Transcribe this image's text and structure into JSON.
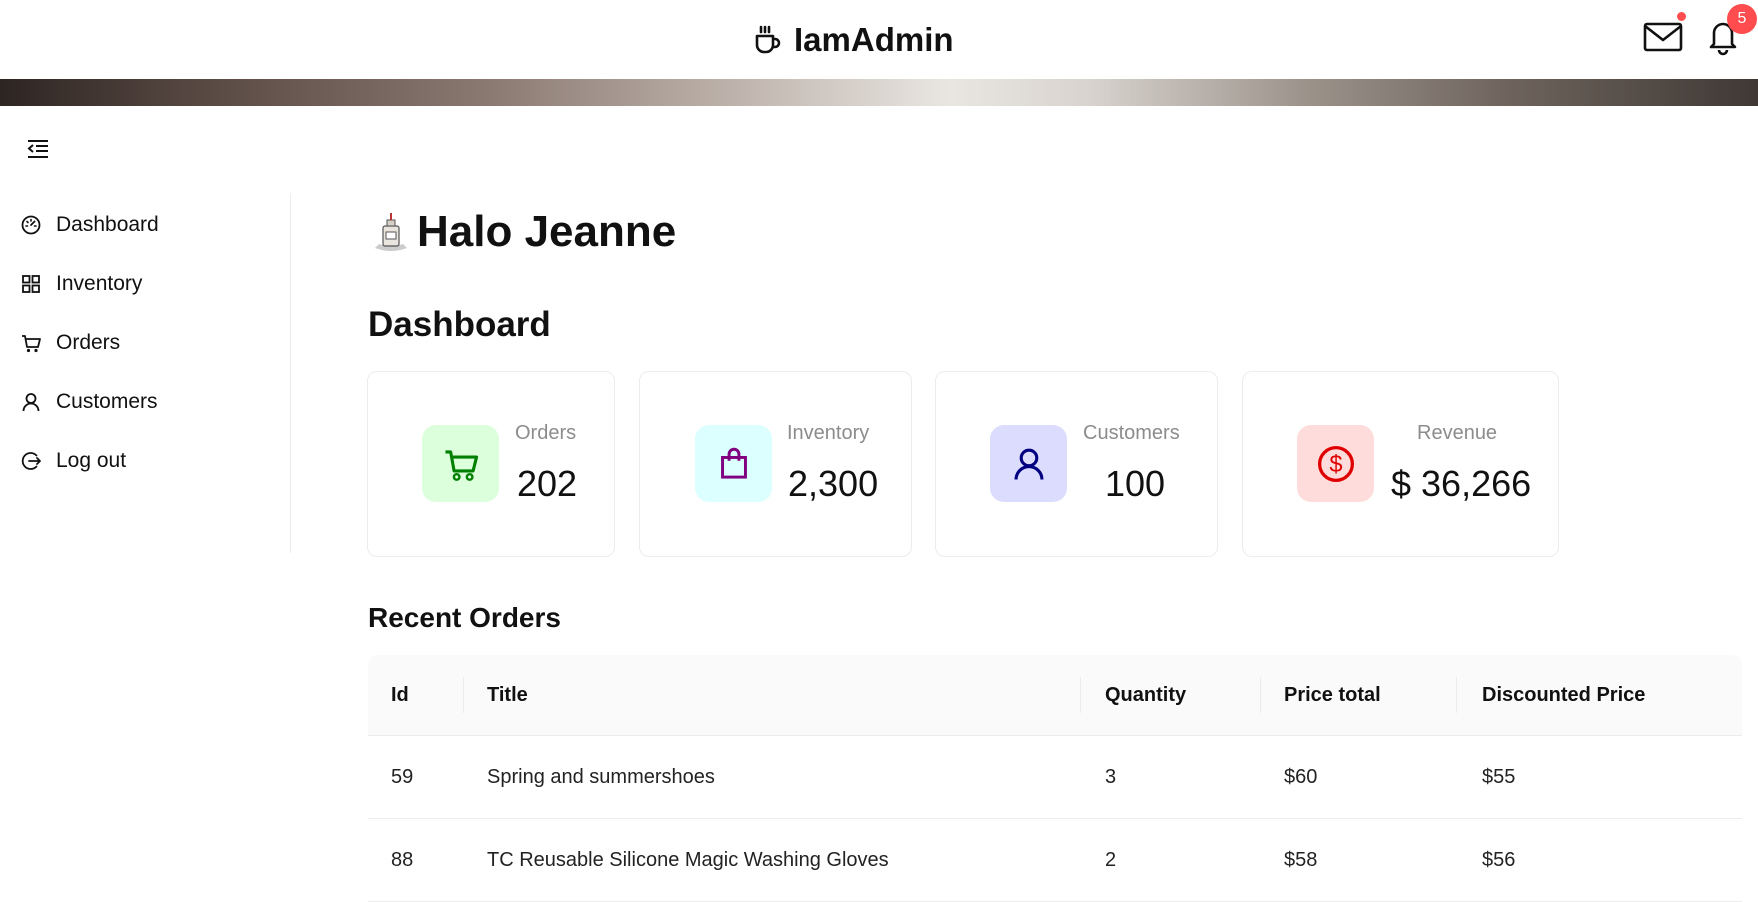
{
  "app": {
    "title": "IamAdmin"
  },
  "header": {
    "notification_count": "5"
  },
  "sidebar": {
    "items": [
      {
        "label": "Dashboard",
        "icon": "speedometer-icon"
      },
      {
        "label": "Inventory",
        "icon": "grid-icon"
      },
      {
        "label": "Orders",
        "icon": "cart-icon"
      },
      {
        "label": "Customers",
        "icon": "user-icon"
      },
      {
        "label": "Log out",
        "icon": "logout-icon"
      }
    ]
  },
  "main": {
    "greeting": "Halo Jeanne",
    "dashboard_title": "Dashboard",
    "cards": [
      {
        "label": "Orders",
        "value": "202",
        "icon": "cart-icon",
        "color": "#008000",
        "bg": "#dcffdc"
      },
      {
        "label": "Inventory",
        "value": "2,300",
        "icon": "shopping-bag-icon",
        "color": "#800080",
        "bg": "#dcffff"
      },
      {
        "label": "Customers",
        "value": "100",
        "icon": "user-icon",
        "color": "#000080",
        "bg": "#dcdcff"
      },
      {
        "label": "Revenue",
        "value": "$ 36,266",
        "icon": "dollar-circle-icon",
        "color": "#e00000",
        "bg": "#ffdcdc"
      }
    ],
    "recent_orders": {
      "title": "Recent Orders",
      "columns": [
        "Id",
        "Title",
        "Quantity",
        "Price total",
        "Discounted Price"
      ],
      "rows": [
        [
          "59",
          "Spring and summershoes",
          "3",
          "$60",
          "$55"
        ],
        [
          "88",
          "TC Reusable Silicone Magic Washing Gloves",
          "2",
          "$58",
          "$56"
        ]
      ]
    }
  }
}
